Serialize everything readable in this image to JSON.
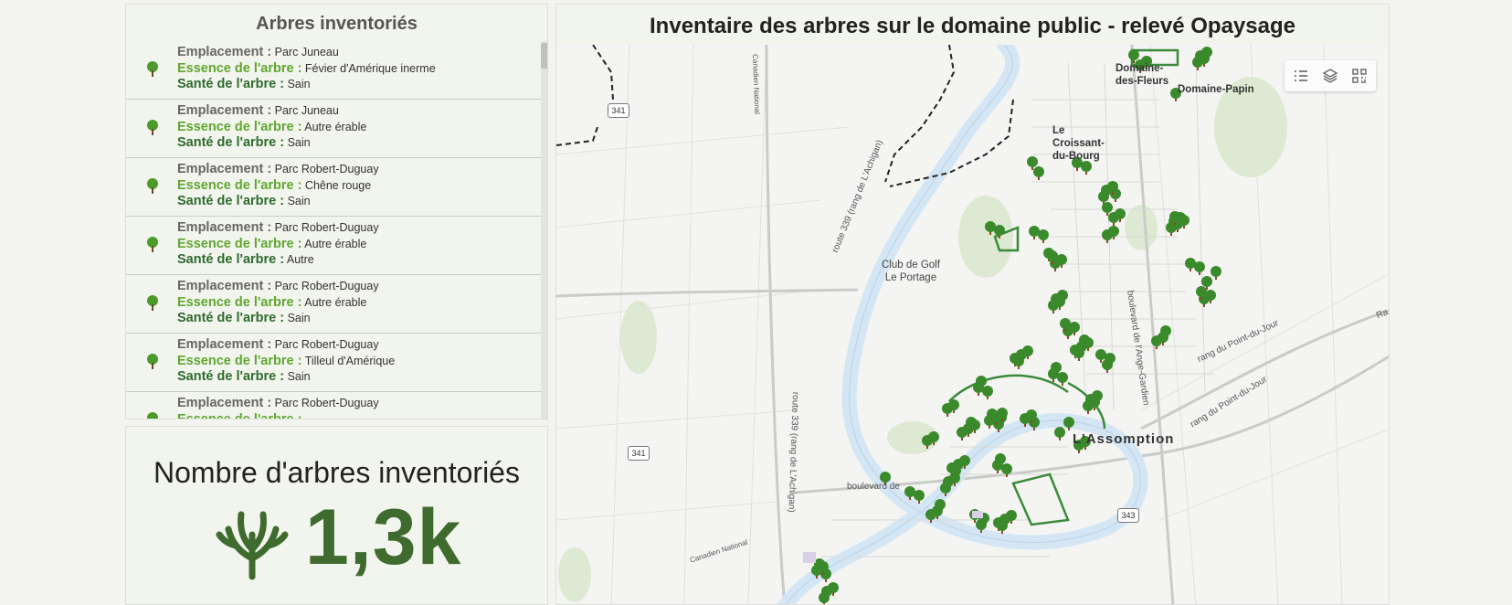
{
  "list_panel": {
    "title": "Arbres inventoriés",
    "labels": {
      "location": "Emplacement :",
      "species": "Essence de l'arbre :",
      "health": "Santé de l'arbre :"
    },
    "items": [
      {
        "location": "Parc Juneau",
        "species": "Févier d'Amérique inerme",
        "health": "Sain"
      },
      {
        "location": "Parc Juneau",
        "species": "Autre érable",
        "health": "Sain"
      },
      {
        "location": "Parc Robert-Duguay",
        "species": "Chêne rouge",
        "health": "Sain"
      },
      {
        "location": "Parc Robert-Duguay",
        "species": "Autre érable",
        "health": "Autre"
      },
      {
        "location": "Parc Robert-Duguay",
        "species": "Autre érable",
        "health": "Sain"
      },
      {
        "location": "Parc Robert-Duguay",
        "species": "Tilleul d'Amérique",
        "health": "Sain"
      },
      {
        "location": "Parc Robert-Duguay",
        "species": "",
        "health": ""
      }
    ]
  },
  "count_panel": {
    "title": "Nombre d'arbres inventoriés",
    "value": "1,3k",
    "icon": "tree-branch-icon"
  },
  "map_panel": {
    "title": "Inventaire des arbres sur le domaine public - relevé Opaysage",
    "tools": [
      "legend-list-icon",
      "layers-icon",
      "qr-code-icon"
    ],
    "labels": {
      "domaine_fleurs": "Domaine-\ndes-Fleurs",
      "domaine_papin": "Domaine-Papin",
      "croissant": "Le\nCroissant-\ndu-Bourg",
      "golf": "Club de Golf\nLe Portage",
      "assomption": "L'Assomption",
      "boulevard_ange": "boulevard de l'Ange-Gardien",
      "route339_a": "route 339 (rang de L'Achigan)",
      "route339_b": "route 339 (rang de L'Achigan)",
      "rang_point_1": "rang du Point-du-Jour",
      "rang_point_2": "rang du Point-du-Jour",
      "boulevard_de": "boulevard de",
      "canadien_national": "Canadien National",
      "canadien_national_2": "Canadien National",
      "rang_ra": "Ra"
    },
    "shields": [
      "341",
      "341",
      "343"
    ]
  },
  "colors": {
    "accent_green": "#5fa62e",
    "dark_green": "#2e6b2e",
    "count_green": "#3f6b2e",
    "river": "#d4e6f4",
    "tree_marker": "#3a8a2c"
  }
}
